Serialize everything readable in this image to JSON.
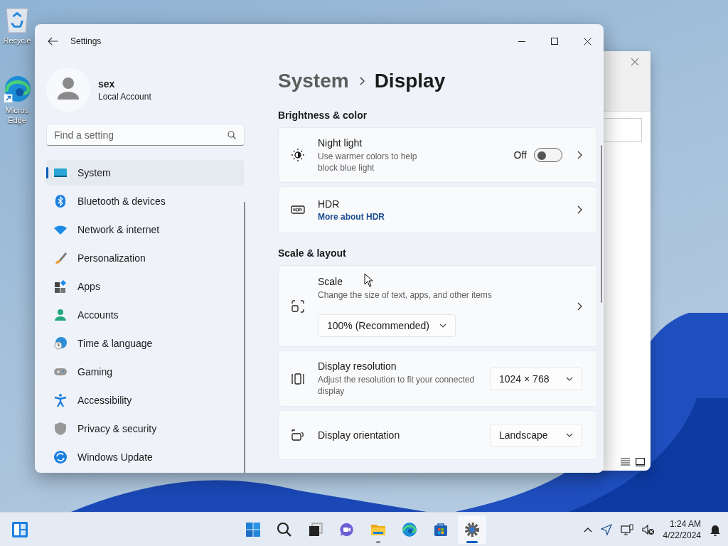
{
  "desktop_icons": [
    {
      "lines": [
        "Recycle"
      ]
    },
    {
      "lines": [
        "Micros",
        "Edge"
      ]
    }
  ],
  "settings_window": {
    "title": "Settings",
    "user": {
      "name": "sex",
      "account": "Local Account"
    },
    "search": {
      "placeholder": "Find a setting"
    },
    "nav_items": [
      {
        "label": "System",
        "selected": true
      },
      {
        "label": "Bluetooth & devices",
        "selected": false
      },
      {
        "label": "Network & internet",
        "selected": false
      },
      {
        "label": "Personalization",
        "selected": false
      },
      {
        "label": "Apps",
        "selected": false
      },
      {
        "label": "Accounts",
        "selected": false
      },
      {
        "label": "Time & language",
        "selected": false
      },
      {
        "label": "Gaming",
        "selected": false
      },
      {
        "label": "Accessibility",
        "selected": false
      },
      {
        "label": "Privacy & security",
        "selected": false
      },
      {
        "label": "Windows Update",
        "selected": false
      }
    ],
    "breadcrumb": [
      "System",
      "Display"
    ],
    "sections": [
      {
        "title": "Brightness & color",
        "cards": [
          {
            "kind": "toggle",
            "title": "Night light",
            "subtitle": "Use warmer colors to help block blue light",
            "state_label": "Off",
            "on": false
          },
          {
            "kind": "link",
            "title": "HDR",
            "link": "More about HDR"
          }
        ]
      },
      {
        "title": "Scale & layout",
        "cards": [
          {
            "kind": "scale",
            "title": "Scale",
            "subtitle": "Change the size of text, apps, and other items",
            "value": "100% (Recommended)"
          },
          {
            "kind": "dropdown",
            "title": "Display resolution",
            "subtitle": "Adjust the resolution to fit your connected display",
            "value": "1024 × 768"
          },
          {
            "kind": "dropdown",
            "title": "Display orientation",
            "value": "Landscape"
          }
        ]
      }
    ]
  },
  "taskbar": {
    "apps": [
      {
        "selected": false,
        "running": false
      },
      {
        "selected": false,
        "running": false
      },
      {
        "selected": false,
        "running": false
      },
      {
        "selected": false,
        "running": false
      },
      {
        "selected": false,
        "running": true
      },
      {
        "selected": false,
        "running": false
      },
      {
        "selected": false,
        "running": false
      },
      {
        "selected": true,
        "running": true
      }
    ],
    "time": "1:24 AM",
    "date": "4/22/2024"
  }
}
